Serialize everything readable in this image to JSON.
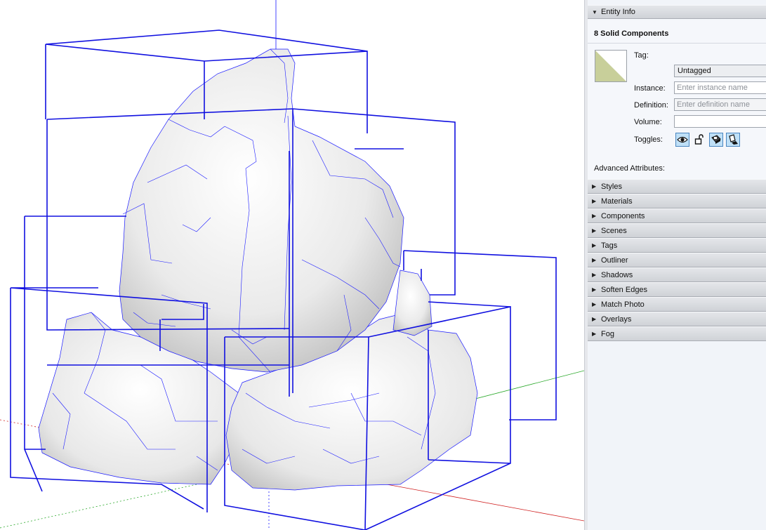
{
  "colors": {
    "bounding_box": "#1010e0",
    "panel_header": "#d6d9de",
    "tray_background": "#f1f4f9",
    "material_swatch": "#c8cf9a",
    "axis_green": "#29a829",
    "axis_red": "#d02020",
    "axis_blue": "#1a1aff"
  },
  "entity_info": {
    "header": "Entity Info",
    "title": "8 Solid Components",
    "tag_label": "Tag:",
    "tag_value": "Untagged",
    "instance_label": "Instance:",
    "instance_placeholder": "Enter instance name",
    "definition_label": "Definition:",
    "definition_placeholder": "Enter definition name",
    "volume_label": "Volume:",
    "volume_value": "",
    "toggles_label": "Toggles:",
    "toggles": [
      {
        "icon": "eye-icon",
        "active": true
      },
      {
        "icon": "lock-icon",
        "active": false
      },
      {
        "icon": "receive-shadows-icon",
        "active": true
      },
      {
        "icon": "cast-shadows-icon",
        "active": true
      }
    ],
    "advanced_label": "Advanced Attributes:"
  },
  "panels": [
    "Styles",
    "Materials",
    "Components",
    "Scenes",
    "Tags",
    "Outliner",
    "Shadows",
    "Soften Edges",
    "Match Photo",
    "Overlays",
    "Fog"
  ]
}
